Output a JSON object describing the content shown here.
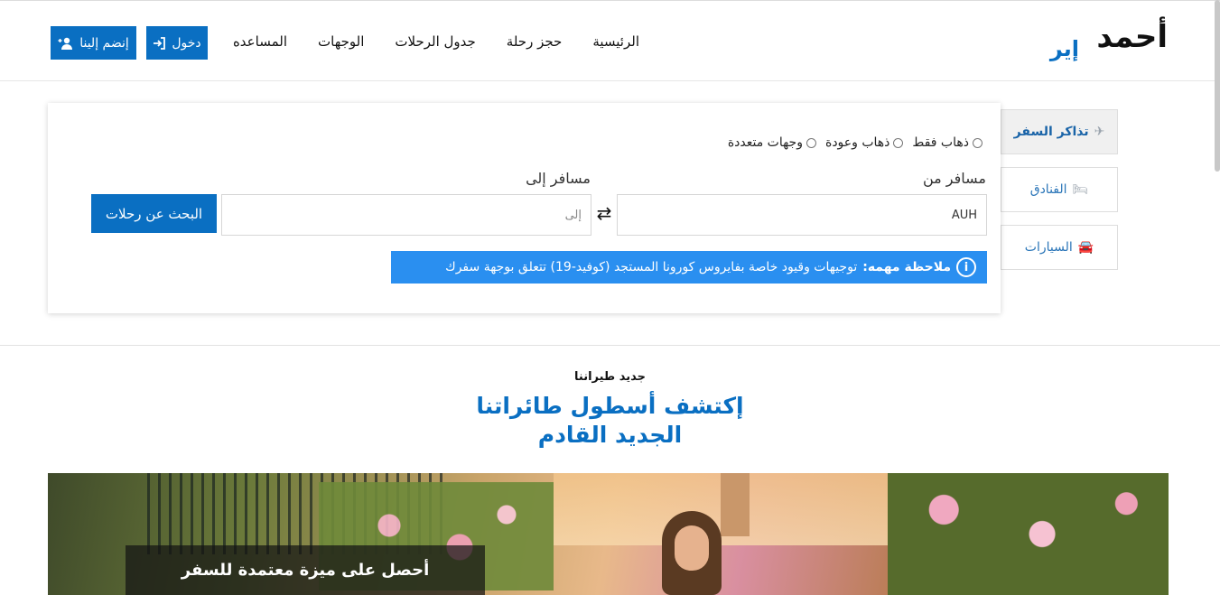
{
  "brand": {
    "logo_main": "أحمد",
    "logo_sub": "إير"
  },
  "nav": {
    "items": [
      {
        "label": "الرئيسية"
      },
      {
        "label": "حجز رحلة"
      },
      {
        "label": "جدول الرحلات"
      },
      {
        "label": "الوجهات"
      },
      {
        "label": "المساعده"
      }
    ],
    "login_label": "دخول",
    "login_icon": "sign-in-icon",
    "join_label": "إنضم إلينا",
    "join_icon": "user-plus-icon"
  },
  "side_tabs": [
    {
      "label": "تذاكر السفر",
      "icon": "plane-icon",
      "glyph": "✈"
    },
    {
      "label": "الفنادق",
      "icon": "bed-icon",
      "glyph": "🛏"
    },
    {
      "label": "السيارات",
      "icon": "car-icon",
      "glyph": "🚘"
    }
  ],
  "search": {
    "trip_types": [
      {
        "label": "ذهاب فقط"
      },
      {
        "label": "ذهاب وعودة"
      },
      {
        "label": "وجهات متعددة"
      }
    ],
    "from_label": "مسافر من",
    "from_value": "AUH",
    "to_label": "مسافر إلى",
    "to_placeholder": "إلى",
    "swap_glyph": "⇄",
    "button_label": "البحث عن رحلات",
    "notice_title": "ملاحظة مهمه:",
    "notice_text": "توجيهات وقيود خاصة بفايروس كورونا المستجد (كوفيد-19) تتعلق بوجهة سفرك"
  },
  "fleet": {
    "eyebrow": "جديد طيراننا",
    "headline_line1": "إكتشف أسطول طائراتنا",
    "headline_line2": "الجديد القادم"
  },
  "banner": {
    "caption": "أحصل على ميزة معتمدة للسفر"
  },
  "colors": {
    "primary": "#0a6fc2",
    "notice_bg": "#2a8ff0"
  }
}
